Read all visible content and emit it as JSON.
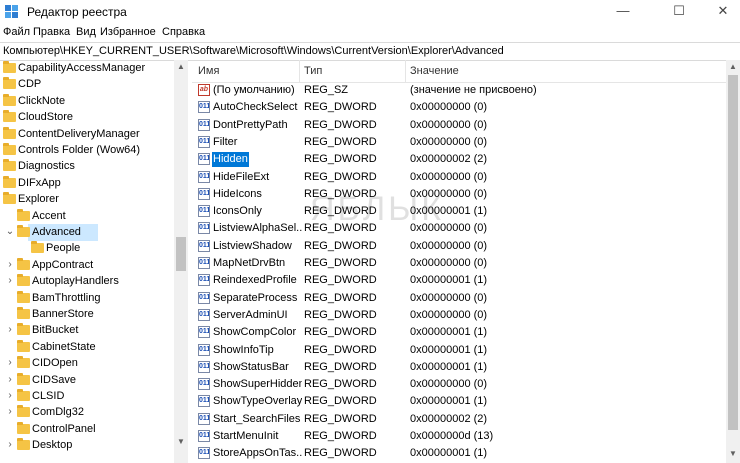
{
  "window": {
    "title": "Редактор реестра",
    "controls": [
      "—",
      "☐",
      "✕"
    ]
  },
  "menu": [
    "Файл",
    "Правка",
    "Вид",
    "Избранное",
    "Справка"
  ],
  "address": "Компьютер\\HKEY_CURRENT_USER\\Software\\Microsoft\\Windows\\CurrentVersion\\Explorer\\Advanced",
  "tree": [
    {
      "label": "CapabilityAccessManager",
      "level": 0,
      "expander": ""
    },
    {
      "label": "CDP",
      "level": 0,
      "expander": ""
    },
    {
      "label": "ClickNote",
      "level": 0,
      "expander": ""
    },
    {
      "label": "CloudStore",
      "level": 0,
      "expander": ""
    },
    {
      "label": "ContentDeliveryManager",
      "level": 0,
      "expander": ""
    },
    {
      "label": "Controls Folder (Wow64)",
      "level": 0,
      "expander": ""
    },
    {
      "label": "Diagnostics",
      "level": 0,
      "expander": ""
    },
    {
      "label": "DIFxApp",
      "level": 0,
      "expander": ""
    },
    {
      "label": "Explorer",
      "level": 0,
      "expander": ""
    },
    {
      "label": "Accent",
      "level": 1,
      "expander": ""
    },
    {
      "label": "Advanced",
      "level": 1,
      "expander": "⌄",
      "selected": true
    },
    {
      "label": "People",
      "level": 2,
      "expander": ""
    },
    {
      "label": "AppContract",
      "level": 1,
      "expander": "›"
    },
    {
      "label": "AutoplayHandlers",
      "level": 1,
      "expander": "›"
    },
    {
      "label": "BamThrottling",
      "level": 1,
      "expander": ""
    },
    {
      "label": "BannerStore",
      "level": 1,
      "expander": ""
    },
    {
      "label": "BitBucket",
      "level": 1,
      "expander": "›"
    },
    {
      "label": "CabinetState",
      "level": 1,
      "expander": ""
    },
    {
      "label": "CIDOpen",
      "level": 1,
      "expander": "›"
    },
    {
      "label": "CIDSave",
      "level": 1,
      "expander": "›"
    },
    {
      "label": "CLSID",
      "level": 1,
      "expander": "›"
    },
    {
      "label": "ComDlg32",
      "level": 1,
      "expander": "›"
    },
    {
      "label": "ControlPanel",
      "level": 1,
      "expander": ""
    },
    {
      "label": "Desktop",
      "level": 1,
      "expander": "›"
    }
  ],
  "columns": {
    "name": "Имя",
    "type": "Тип",
    "data": "Значение"
  },
  "values": [
    {
      "name": "(По умолчанию)",
      "type": "REG_SZ",
      "data": "(значение не присвоено)",
      "icon": "ab"
    },
    {
      "name": "AutoCheckSelect",
      "type": "REG_DWORD",
      "data": "0x00000000 (0)",
      "icon": "011"
    },
    {
      "name": "DontPrettyPath",
      "type": "REG_DWORD",
      "data": "0x00000000 (0)",
      "icon": "011"
    },
    {
      "name": "Filter",
      "type": "REG_DWORD",
      "data": "0x00000000 (0)",
      "icon": "011"
    },
    {
      "name": "Hidden",
      "type": "REG_DWORD",
      "data": "0x00000002 (2)",
      "icon": "011",
      "selected": true
    },
    {
      "name": "HideFileExt",
      "type": "REG_DWORD",
      "data": "0x00000000 (0)",
      "icon": "011"
    },
    {
      "name": "HideIcons",
      "type": "REG_DWORD",
      "data": "0x00000000 (0)",
      "icon": "011"
    },
    {
      "name": "IconsOnly",
      "type": "REG_DWORD",
      "data": "0x00000001 (1)",
      "icon": "011"
    },
    {
      "name": "ListviewAlphaSel...",
      "type": "REG_DWORD",
      "data": "0x00000000 (0)",
      "icon": "011"
    },
    {
      "name": "ListviewShadow",
      "type": "REG_DWORD",
      "data": "0x00000000 (0)",
      "icon": "011"
    },
    {
      "name": "MapNetDrvBtn",
      "type": "REG_DWORD",
      "data": "0x00000000 (0)",
      "icon": "011"
    },
    {
      "name": "ReindexedProfile",
      "type": "REG_DWORD",
      "data": "0x00000001 (1)",
      "icon": "011"
    },
    {
      "name": "SeparateProcess",
      "type": "REG_DWORD",
      "data": "0x00000000 (0)",
      "icon": "011"
    },
    {
      "name": "ServerAdminUI",
      "type": "REG_DWORD",
      "data": "0x00000000 (0)",
      "icon": "011"
    },
    {
      "name": "ShowCompColor",
      "type": "REG_DWORD",
      "data": "0x00000001 (1)",
      "icon": "011"
    },
    {
      "name": "ShowInfoTip",
      "type": "REG_DWORD",
      "data": "0x00000001 (1)",
      "icon": "011"
    },
    {
      "name": "ShowStatusBar",
      "type": "REG_DWORD",
      "data": "0x00000001 (1)",
      "icon": "011"
    },
    {
      "name": "ShowSuperHidden",
      "type": "REG_DWORD",
      "data": "0x00000000 (0)",
      "icon": "011"
    },
    {
      "name": "ShowTypeOverlay",
      "type": "REG_DWORD",
      "data": "0x00000001 (1)",
      "icon": "011"
    },
    {
      "name": "Start_SearchFiles",
      "type": "REG_DWORD",
      "data": "0x00000002 (2)",
      "icon": "011"
    },
    {
      "name": "StartMenuInit",
      "type": "REG_DWORD",
      "data": "0x0000000d (13)",
      "icon": "011"
    },
    {
      "name": "StoreAppsOnTas...",
      "type": "REG_DWORD",
      "data": "0x00000001 (1)",
      "icon": "011"
    }
  ],
  "watermark": "ЯБЛЫК",
  "colors": {
    "selection": "#0078d7",
    "tree_selection": "#cce8ff",
    "folder": "#f5c445"
  }
}
